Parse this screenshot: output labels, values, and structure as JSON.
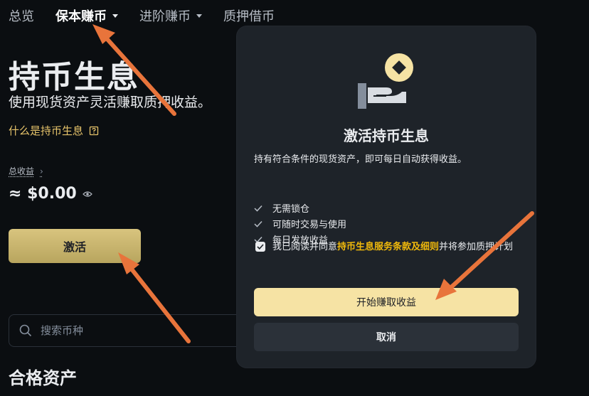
{
  "nav": {
    "items": [
      {
        "label": "总览",
        "active": false,
        "dropdown": false
      },
      {
        "label": "保本赚币",
        "active": true,
        "dropdown": true
      },
      {
        "label": "进阶赚币",
        "active": false,
        "dropdown": true
      },
      {
        "label": "质押借币",
        "active": false,
        "dropdown": false
      }
    ]
  },
  "hero": {
    "title": "持币生息",
    "subtitle": "使用现货资产灵活赚取质押收益。",
    "whatis_link": "什么是持币生息",
    "whatis_icon": "help-doc-icon"
  },
  "earnings": {
    "label": "总收益",
    "value": "≈ $0.00",
    "eye_icon": "eye-icon"
  },
  "activate_button": "激活",
  "search": {
    "placeholder": "搜索币种",
    "icon": "search-icon"
  },
  "section_title": "合格资产",
  "modal": {
    "title": "激活持币生息",
    "description": "持有符合条件的现货资产，即可每日自动获得收益。",
    "features": [
      "无需锁仓",
      "可随时交易与使用",
      "每日发放收益"
    ],
    "agree": {
      "prefix": "我已阅读并同意",
      "link": "持币生息服务条款及细则",
      "suffix": "并将参加质押计划",
      "checked": true
    },
    "primary_button": "开始赚取收益",
    "cancel_button": "取消"
  },
  "colors": {
    "background": "#0b0e11",
    "modal_background": "#1e2329",
    "accent_gold": "#f0b90b",
    "link_gold": "#e6c36a",
    "arrow": "#e8743b"
  }
}
